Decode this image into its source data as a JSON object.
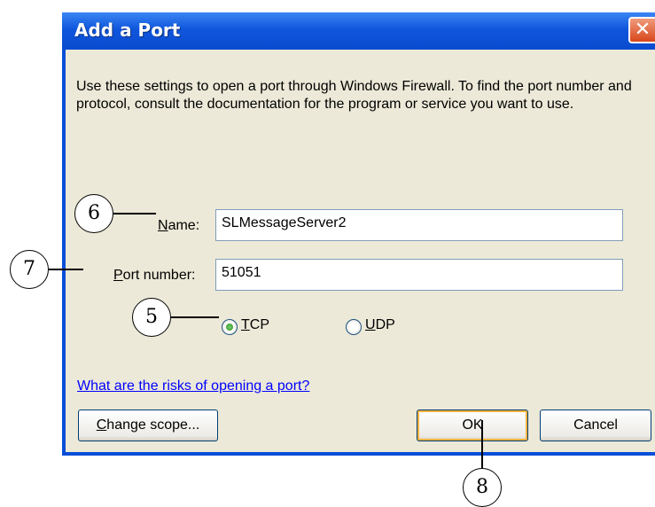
{
  "dialog": {
    "title": "Add a Port",
    "close_label": "✕",
    "description": "Use these settings to open a port through Windows Firewall. To find the port number and protocol, consult the documentation for the program or service you want to use.",
    "name_label_ul": "N",
    "name_label_rest": "ame:",
    "name_value": "SLMessageServer2",
    "port_label_ul": "P",
    "port_label_rest": "ort number:",
    "port_value": "51051",
    "tcp_ul": "T",
    "tcp_rest": "CP",
    "udp_ul": "U",
    "udp_rest": "DP",
    "protocol_selected": "TCP",
    "risk_link": "What are the risks of opening a port?",
    "change_scope_ul": "C",
    "change_scope_rest": "hange scope...",
    "ok_label": "OK",
    "cancel_label": "Cancel"
  },
  "callouts": {
    "c5": "5",
    "c6": "6",
    "c7": "7",
    "c8": "8"
  }
}
